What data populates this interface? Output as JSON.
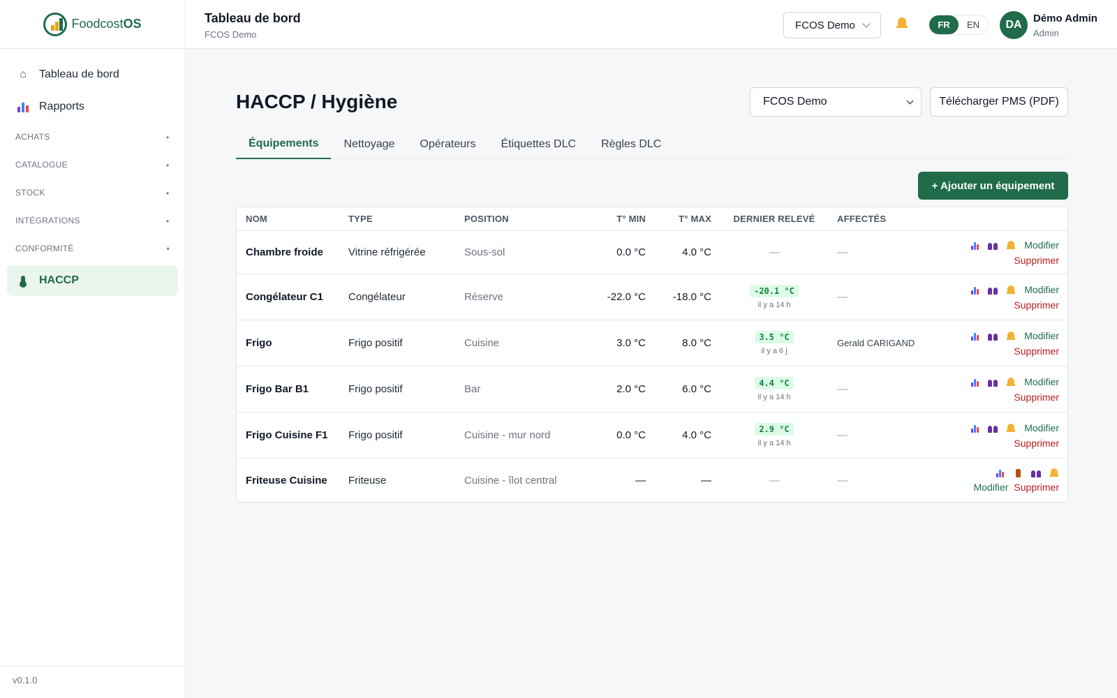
{
  "brand": {
    "name_part1": "Foodcost",
    "name_part2": "OS"
  },
  "sidebar": {
    "items": [
      {
        "label": "Tableau de bord",
        "icon": "home-icon"
      },
      {
        "label": "Rapports",
        "icon": "bar-chart-icon"
      }
    ],
    "sections": [
      {
        "label": "ACHATS",
        "state": "collapsed"
      },
      {
        "label": "CATALOGUE",
        "state": "collapsed"
      },
      {
        "label": "STOCK",
        "state": "collapsed"
      },
      {
        "label": "INTÉGRATIONS",
        "state": "collapsed"
      },
      {
        "label": "CONFORMITÉ",
        "state": "expanded"
      }
    ],
    "active_item": {
      "label": "HACCP",
      "icon": "thermometer-icon"
    },
    "version": "v0.1.0"
  },
  "topbar": {
    "title": "Tableau de bord",
    "subtitle": "FCOS Demo",
    "org_select": "FCOS Demo",
    "lang_fr": "FR",
    "lang_en": "EN",
    "user": {
      "initials": "DA",
      "name": "Démo Admin",
      "role": "Admin"
    }
  },
  "main": {
    "title": "HACCP / Hygiène",
    "site_select": "FCOS Demo",
    "pms_button": "Télécharger PMS (PDF)",
    "tabs": [
      "Équipements",
      "Nettoyage",
      "Opérateurs",
      "Étiquettes DLC",
      "Règles DLC"
    ],
    "active_tab": 0,
    "add_button": "+ Ajouter un équipement"
  },
  "table": {
    "headers": {
      "name": "NOM",
      "type": "TYPE",
      "position": "POSITION",
      "tmin": "T° MIN",
      "tmax": "T° MAX",
      "last": "DERNIER RELEVÉ",
      "assigned": "AFFECTÉS"
    },
    "actions": {
      "edit": "Modifier",
      "delete": "Supprimer"
    },
    "rows": [
      {
        "name": "Chambre froide",
        "type": "Vitrine réfrigérée",
        "position": "Sous-sol",
        "tmin": "0.0 °C",
        "tmax": "4.0 °C",
        "last": "",
        "ago": "",
        "assigned": "—"
      },
      {
        "name": "Congélateur C1",
        "type": "Congélateur",
        "position": "Réserve",
        "tmin": "-22.0 °C",
        "tmax": "-18.0 °C",
        "last": "-20.1 °C",
        "ago": "il y a 14 h",
        "assigned": "—"
      },
      {
        "name": "Frigo",
        "type": "Frigo positif",
        "position": "Cuisine",
        "tmin": "3.0 °C",
        "tmax": "8.0 °C",
        "last": "3.5 °C",
        "ago": "il y a 6 j",
        "assigned": "Gerald CARIGAND"
      },
      {
        "name": "Frigo Bar B1",
        "type": "Frigo positif",
        "position": "Bar",
        "tmin": "2.0 °C",
        "tmax": "6.0 °C",
        "last": "4.4 °C",
        "ago": "il y a 14 h",
        "assigned": "—"
      },
      {
        "name": "Frigo Cuisine F1",
        "type": "Frigo positif",
        "position": "Cuisine - mur nord",
        "tmin": "0.0 °C",
        "tmax": "4.0 °C",
        "last": "2.9 °C",
        "ago": "il y a 14 h",
        "assigned": "—"
      },
      {
        "name": "Friteuse Cuisine",
        "type": "Friteuse",
        "position": "Cuisine - îlot central",
        "tmin": "—",
        "tmax": "—",
        "last": "",
        "ago": "",
        "assigned": "—"
      }
    ]
  },
  "colors": {
    "primary": "#1f6b4a",
    "danger": "#b91c1c",
    "badge_bg": "#dcfce7",
    "badge_text": "#15803d"
  }
}
